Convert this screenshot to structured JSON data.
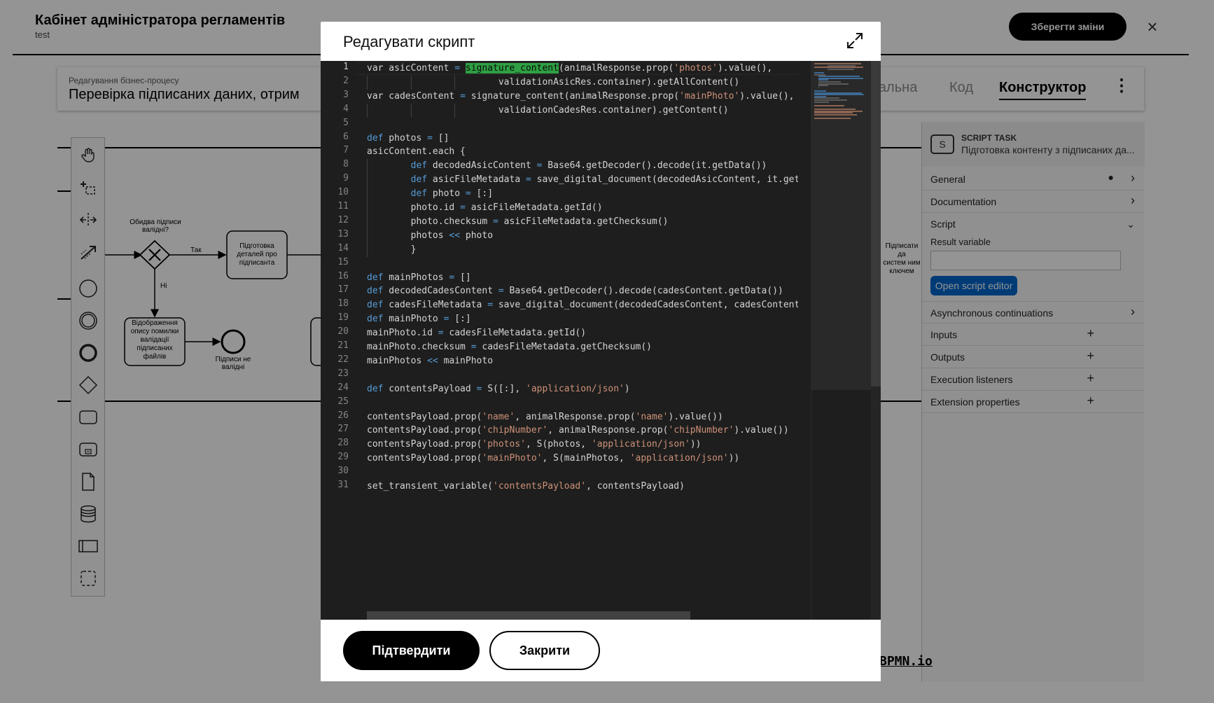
{
  "app": {
    "title": "Кабінет адміністратора регламентів",
    "subtitle": "test",
    "save_label": "Зберегти зміни",
    "close_icon": "close-icon"
  },
  "process": {
    "label": "Редагування бізнес-процесу",
    "name": "Перевірка підписаних даних, отрим",
    "tabs": [
      "тальна",
      "Код",
      "Конструктор"
    ],
    "active_tab": "Конструктор"
  },
  "palette": {
    "tools": [
      "hand-tool-icon",
      "lasso-tool-icon",
      "space-tool-icon",
      "connect-tool-icon",
      "start-event-icon",
      "intermediate-event-icon",
      "end-event-icon",
      "gateway-icon",
      "task-icon",
      "subprocess-icon",
      "data-object-icon",
      "data-store-icon",
      "pool-icon",
      "group-icon"
    ]
  },
  "diagram": {
    "gateway_label": "Обидва підписи валідні?",
    "yes_label": "Так",
    "no_label": "Ні",
    "task_prepare": [
      "Підготовка",
      "деталей про",
      "підписанта"
    ],
    "task_error": [
      "Відображення",
      "опису помилки",
      "валідації",
      "підписаних",
      "файлів"
    ],
    "end_label": [
      "Підписи не",
      "валідні"
    ],
    "task_sign": [
      "Підписати да",
      "систем ним",
      "ключем"
    ]
  },
  "properties": {
    "type": "SCRIPT TASK",
    "name": "Підготовка контенту з підписаних да...",
    "sections": [
      {
        "label": "General",
        "icon": "chevron-right"
      },
      {
        "label": "Documentation",
        "icon": "chevron-right"
      },
      {
        "label": "Script",
        "icon": "chevron-down"
      },
      {
        "label": "Asynchronous continuations",
        "icon": "chevron-right"
      },
      {
        "label": "Inputs",
        "icon": "plus"
      },
      {
        "label": "Outputs",
        "icon": "plus"
      },
      {
        "label": "Execution listeners",
        "icon": "plus"
      },
      {
        "label": "Extension properties",
        "icon": "plus"
      }
    ],
    "result_variable_label": "Result variable",
    "result_variable_value": "",
    "open_editor_label": "Open script editor",
    "general_dot": "●"
  },
  "bpmn_logo": "BPMN.io",
  "modal": {
    "title": "Редагувати скрипт",
    "confirm_label": "Підтвердити",
    "close_label": "Закрити",
    "highlight_word": "signature_content",
    "code_lines": [
      "var asicContent = signature_content(animalResponse.prop('photos').value(),",
      "                        validationAsicRes.container).getAllContent()",
      "var cadesContent = signature_content(animalResponse.prop('mainPhoto').value(),",
      "                        validationCadesRes.container).getContent()",
      "",
      "def photos = []",
      "asicContent.each {",
      "        def decodedAsicContent = Base64.getDecoder().decode(it.getData())",
      "        def asicFileMetadata = save_digital_document(decodedAsicContent, it.get",
      "        def photo = [:]",
      "        photo.id = asicFileMetadata.getId()",
      "        photo.checksum = asicFileMetadata.getChecksum()",
      "        photos << photo",
      "        }",
      "",
      "def mainPhotos = []",
      "def decodedCadesContent = Base64.getDecoder().decode(cadesContent.getData())",
      "def cadesFileMetadata = save_digital_document(decodedCadesContent, cadesContent",
      "def mainPhoto = [:]",
      "mainPhoto.id = cadesFileMetadata.getId()",
      "mainPhoto.checksum = cadesFileMetadata.getChecksum()",
      "mainPhotos << mainPhoto",
      "",
      "def contentsPayload = S([:], 'application/json')",
      "",
      "contentsPayload.prop('name', animalResponse.prop('name').value())",
      "contentsPayload.prop('chipNumber', animalResponse.prop('chipNumber').value())",
      "contentsPayload.prop('photos', S(photos, 'application/json'))",
      "contentsPayload.prop('mainPhoto', S(mainPhotos, 'application/json'))",
      "",
      "set_transient_variable('contentsPayload', contentsPayload)"
    ]
  }
}
